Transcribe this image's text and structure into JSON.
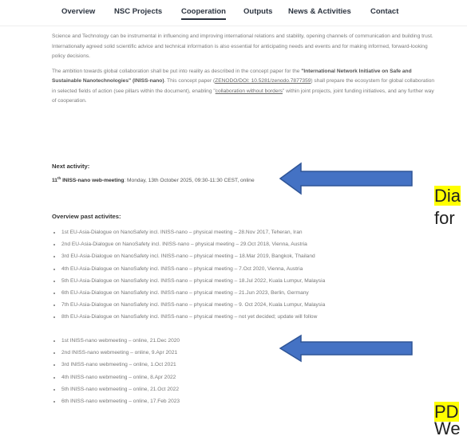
{
  "nav": {
    "items": [
      "Overview",
      "NSC Projects",
      "Cooperation",
      "Outputs",
      "News & Activities",
      "Contact"
    ],
    "active": "Cooperation"
  },
  "intro": {
    "p1": "Science and Technology can be instrumental in influencing and improving international relations and stability, opening channels of communication and building trust. Internationally agreed solid scientific advice and technical information is also essential for anticipating needs and events and for making informed, forward-looking policy decisions.",
    "p2_pre": "The ambition towards global collaboration shall be put into reality as described in the concept paper for the ",
    "p2_bold": "\"International Network Initiative on Safe and Sustainable Nanotechnologies\" (INISS-nano)",
    "p2_mid1": ". This concept paper (",
    "p2_link1": "ZENODO/DOI: 10.5281/zenodo.7877359",
    "p2_mid2": ") shall prepare the ecosystem for global collaboration in selected fields of action (see pillars within the document), enabling \"",
    "p2_link2": "collaboration without borders",
    "p2_post": "\" within joint projects, joint funding initiatives, and any further way of cooperation."
  },
  "next_activity": {
    "heading": "Next activity:",
    "ordinal_num": "11",
    "ordinal_suffix": "th",
    "title": " INISS-nano web-meeting",
    "details": ": Monday, 13th October 2025, 09:30-11:30 CEST, online"
  },
  "past": {
    "heading": "Overview past activites:",
    "dialogues": [
      "1st EU-Asia-Dialogue on NanoSafety incl. INISS-nano – physical meeting – 28.Nov 2017, Teheran, Iran",
      "2nd EU-Asia-Dialogue on NanoSafety incl. INISS-nano – physical meeting – 29.Oct 2018, Vienna, Austria",
      "3rd EU-Asia-Dialogue on NanoSafety incl. INISS-nano – physical meeting – 18.Mar 2019, Bangkok, Thailand",
      "4th EU-Asia-Dialogue on NanoSafety incl. INISS-nano – physical meeting – 7.Oct 2020, Vienna, Austria",
      "5th EU-Asia-Dialogue on NanoSafety incl. INISS-nano – physical meeting – 18.Jul 2022, Kuala Lumpur, Malaysia",
      "6th EU-Asia-Dialogue on NanoSafety incl. INISS-nano – physical meeting – 21.Jun 2023, Berlin, Germany",
      "7th EU-Asia-Dialogue on NanoSafety incl. INISS-nano – physical meeting – 9. Oct 2024, Kuala Lumpur, Malaysia",
      "8th EU-Asia-Dialogue on NanoSafety incl. INISS-nano – physical meeting – not yet decided; update will follow"
    ],
    "webmeetings": [
      "1st INISS-nano webmeeting – online, 21.Dec 2020",
      "2nd INISS-nano webmeeting – online, 9.Apr 2021",
      "3rd INISS-nano webmeeting – online, 1.Oct 2021",
      "4th INISS-nano webmeeting – online, 8.Apr 2022",
      "5th INISS-nano webmeeting – online, 21.Oct 2022",
      "6th INISS-nano webmeeting – online, 17.Feb 2023"
    ]
  },
  "callouts": {
    "first_hl": "Dia",
    "first_line2": "for",
    "second_hl": "PD",
    "second_line2": "We"
  },
  "colors": {
    "arrow_fill": "#4472c4",
    "arrow_stroke": "#2f5597",
    "highlight": "#ffff00"
  }
}
